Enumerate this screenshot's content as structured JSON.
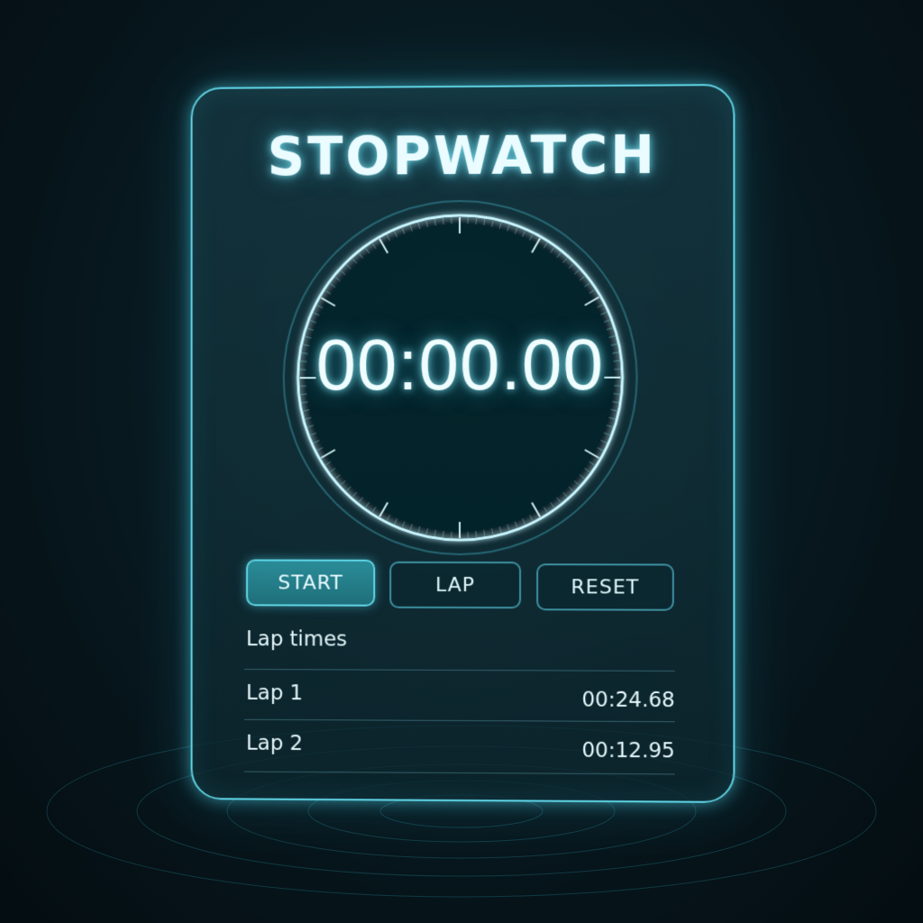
{
  "app": {
    "title": "STOPWATCH"
  },
  "timer": {
    "display": "00:00.00"
  },
  "controls": {
    "start_label": "START",
    "lap_label": "LAP",
    "reset_label": "RESET"
  },
  "laps": {
    "heading": "Lap times",
    "items": [
      {
        "label": "Lap 1",
        "time": "00:24.68"
      },
      {
        "label": "Lap 2",
        "time": "00:12.95"
      }
    ]
  },
  "theme": {
    "accent": "#5fd3e4",
    "background": "#081a21",
    "button_active": "#2a8c98"
  }
}
